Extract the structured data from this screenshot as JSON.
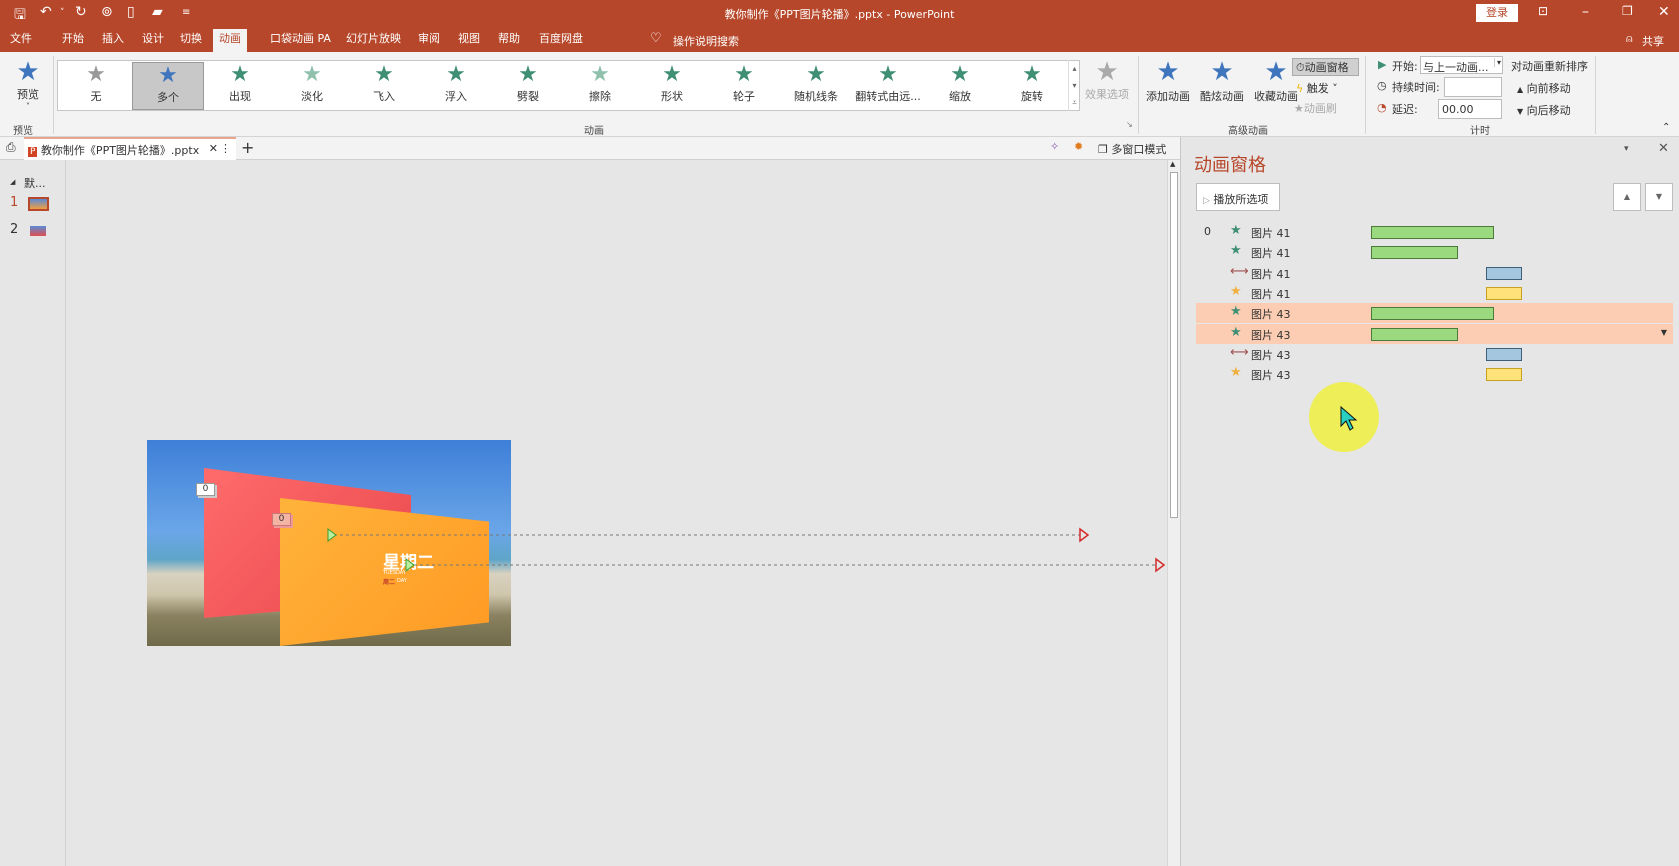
{
  "titlebar": {
    "title": "教你制作《PPT图片轮播》.pptx  -  PowerPoint",
    "login": "登录",
    "icons": [
      "save-icon",
      "undo-icon",
      "redo-icon",
      "present-icon",
      "new-icon",
      "open-icon",
      "customize-icon"
    ]
  },
  "menu": {
    "tabs": [
      "文件",
      "开始",
      "插入",
      "设计",
      "切换",
      "动画",
      "口袋动画 PA",
      "幻灯片放映",
      "审阅",
      "视图",
      "帮助",
      "百度网盘"
    ],
    "active": "动画",
    "search": "操作说明搜索",
    "share": "共享"
  },
  "ribbon": {
    "preview": {
      "label": "预览",
      "group": "预览"
    },
    "gallery": {
      "group": "动画",
      "items": [
        {
          "label": "无",
          "color": "#999999"
        },
        {
          "label": "多个",
          "color": "#3f75bd"
        },
        {
          "label": "出现",
          "color": "#3e8f74"
        },
        {
          "label": "淡化",
          "color": "#8fc1ad"
        },
        {
          "label": "飞入",
          "color": "#3e8f74"
        },
        {
          "label": "浮入",
          "color": "#3e8f74"
        },
        {
          "label": "劈裂",
          "color": "#3e8f74"
        },
        {
          "label": "擦除",
          "color": "#8fc1ad"
        },
        {
          "label": "形状",
          "color": "#3e8f74"
        },
        {
          "label": "轮子",
          "color": "#3e8f74"
        },
        {
          "label": "随机线条",
          "color": "#3e8f74"
        },
        {
          "label": "翻转式由远...",
          "color": "#3e8f74"
        },
        {
          "label": "缩放",
          "color": "#3e8f74"
        },
        {
          "label": "旋转",
          "color": "#3e8f74"
        }
      ],
      "selected": "多个"
    },
    "effect_options": "效果选项",
    "advanced": {
      "group": "高级动画",
      "add": "添加动画",
      "cool": "酷炫动画",
      "fav": "收藏动画",
      "pane": "动画窗格",
      "trigger": "触发",
      "painter": "动画刷"
    },
    "timing": {
      "group": "计时",
      "start_label": "开始:",
      "start_value": "与上一动画...",
      "duration_label": "持续时间:",
      "duration_value": "",
      "delay_label": "延迟:",
      "delay_value": "00.00",
      "reorder": "对动画重新排序",
      "forward": "向前移动",
      "backward": "向后移动"
    }
  },
  "doc": {
    "tab": "教你制作《PPT图片轮播》.pptx",
    "multiwindow": "多窗口模式"
  },
  "thumbs": {
    "section": "默...",
    "slides": [
      "1",
      "2"
    ]
  },
  "slide": {
    "title": "星期二",
    "sub1": "TUESDAY",
    "sub2": "周二",
    "sub3": "DAY",
    "tag1": "0",
    "tag2": "0"
  },
  "pane": {
    "title": "动画窗格",
    "play": "播放所选项",
    "rows": [
      {
        "num": "0",
        "icon": "entrance-star",
        "name": "图片 41",
        "bar": "green-long",
        "color": "#9bd97f"
      },
      {
        "num": "",
        "icon": "entrance-star",
        "name": "图片 41",
        "bar": "green-short",
        "color": "#9bd97f"
      },
      {
        "num": "",
        "icon": "motion-path",
        "name": "图片 41",
        "bar": "blue",
        "color": "#a4c6de"
      },
      {
        "num": "",
        "icon": "emphasis-star",
        "name": "图片 41",
        "bar": "yellow",
        "color": "#ffe27a"
      },
      {
        "num": "",
        "icon": "entrance-star",
        "name": "图片 43",
        "bar": "green-long",
        "color": "#9bd97f"
      },
      {
        "num": "",
        "icon": "entrance-star",
        "name": "图片 43",
        "bar": "green-short",
        "color": "#9bd97f"
      },
      {
        "num": "",
        "icon": "motion-path",
        "name": "图片 43",
        "bar": "blue",
        "color": "#a4c6de"
      },
      {
        "num": "",
        "icon": "emphasis-star",
        "name": "图片 43",
        "bar": "yellow",
        "color": "#ffe27a"
      }
    ],
    "selected_rows": [
      4,
      5
    ]
  },
  "colors": {
    "brand": "#b7472a",
    "pane_title": "#b7472a",
    "selection": "#fccdb3"
  }
}
